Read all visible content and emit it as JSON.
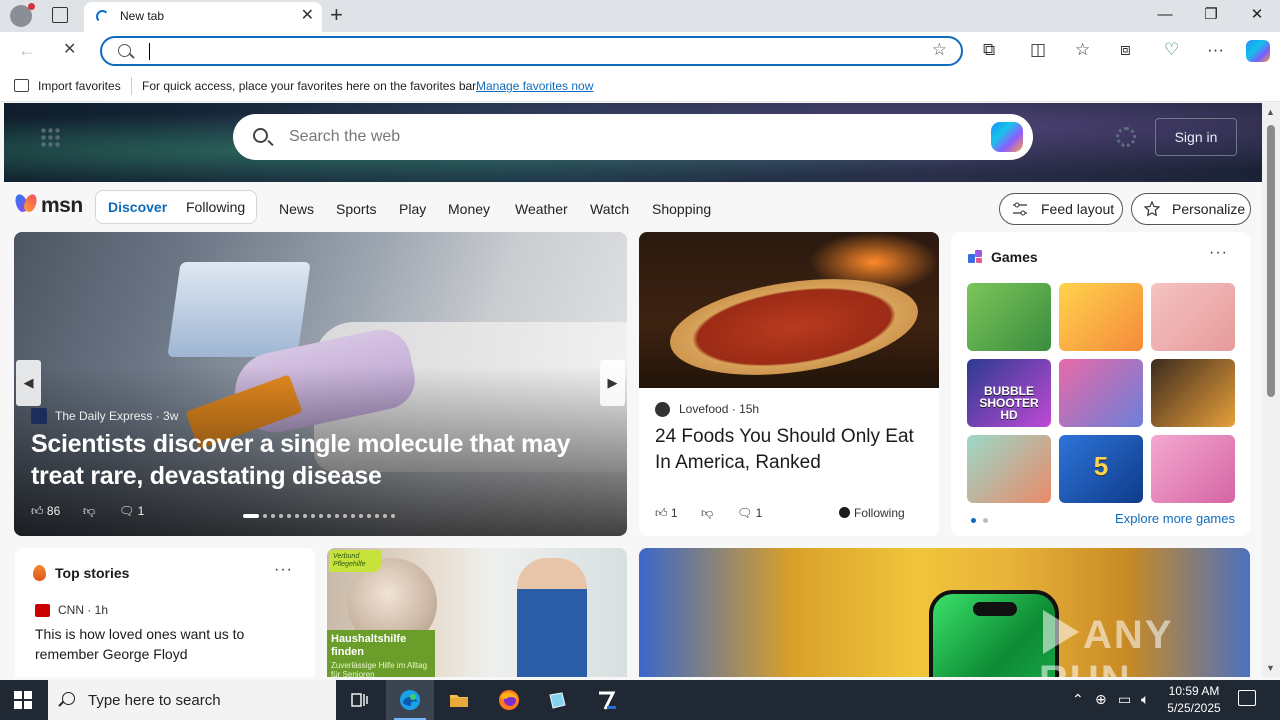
{
  "browser": {
    "tab_title": "New tab",
    "new_tab_symbol": "+",
    "close_symbol": "✕",
    "window": {
      "minimize": "—",
      "restore": "❐",
      "close": "✕"
    },
    "nav": {
      "back": "←",
      "stop": "✕"
    },
    "address": {
      "value": "",
      "placeholder": ""
    },
    "toolbar_icons": [
      "extensions-icon",
      "split-screen-icon",
      "favorites-icon",
      "collections-icon",
      "browser-essentials-icon",
      "more-icon",
      "copilot-icon"
    ],
    "favorites_bar": {
      "import_label": "Import favorites",
      "message": "For quick access, place your favorites here on the favorites bar.",
      "manage_link": "Manage favorites now"
    }
  },
  "msn": {
    "search_placeholder": "Search the web",
    "sign_in": "Sign in",
    "logo_text": "msn",
    "segments": [
      "Discover",
      "Following"
    ],
    "nav_links": [
      "News",
      "Sports",
      "Play",
      "Money",
      "Weather",
      "Watch",
      "Shopping"
    ],
    "feed_layout": "Feed layout",
    "personalize": "Personalize",
    "hero_story": {
      "source": "The Daily Express",
      "age": "3w",
      "title": "Scientists discover a single molecule that may treat rare, devastating disease",
      "likes": "86",
      "comments": "1",
      "slide_count": 18,
      "active_slide": 1
    },
    "side_story": {
      "source": "Lovefood",
      "age": "15h",
      "title": "24 Foods You Should Only Eat In America, Ranked",
      "likes": "1",
      "comments": "1",
      "following": "Following"
    },
    "games": {
      "title": "Games",
      "more": "···",
      "explore": "Explore more games",
      "tiles": [
        {
          "name": "game-tile-puzzle",
          "label": "",
          "colors": [
            "#7cc65a",
            "#3a8c3e"
          ]
        },
        {
          "name": "game-tile-cupcake",
          "label": "",
          "colors": [
            "#ffd34d",
            "#f58a3a"
          ]
        },
        {
          "name": "game-tile-dressup",
          "label": "",
          "colors": [
            "#f6c3c3",
            "#e59a9a"
          ]
        },
        {
          "name": "game-tile-bubble-shooter",
          "label": "BUBBLE SHOOTER HD",
          "colors": [
            "#2b3b8f",
            "#c04ad6"
          ]
        },
        {
          "name": "game-tile-makeup",
          "label": "",
          "colors": [
            "#e86aa8",
            "#6b7fd9"
          ]
        },
        {
          "name": "game-tile-adventure",
          "label": "",
          "colors": [
            "#3c2a1e",
            "#e8a03a"
          ]
        },
        {
          "name": "game-tile-hospital",
          "label": "",
          "colors": [
            "#9bd8c8",
            "#e98a6a"
          ]
        },
        {
          "name": "game-tile-fish",
          "label": "5",
          "colors": [
            "#2d74d9",
            "#0f3b8a"
          ]
        },
        {
          "name": "game-tile-princess",
          "label": "",
          "colors": [
            "#f4a8d0",
            "#d565a4"
          ]
        }
      ],
      "pages": 2
    },
    "top_stories": {
      "title": "Top stories",
      "more": "···",
      "source": "CNN",
      "age": "1h",
      "headline": "This is how loved ones want us to remember George Floyd"
    },
    "ad": {
      "badge": "Verbund Pflegehilfe",
      "title": "Haushaltshilfe finden",
      "subtitle": "Zuverlässige Hilfe im Alltag für Senioren"
    },
    "watermark": "ANY RUN"
  },
  "taskbar": {
    "search_placeholder": "Type here to search",
    "time": "10:59 AM",
    "date": "5/25/2025",
    "apps": [
      "task-view",
      "edge",
      "file-explorer",
      "firefox",
      "notepad",
      "7zip"
    ]
  }
}
